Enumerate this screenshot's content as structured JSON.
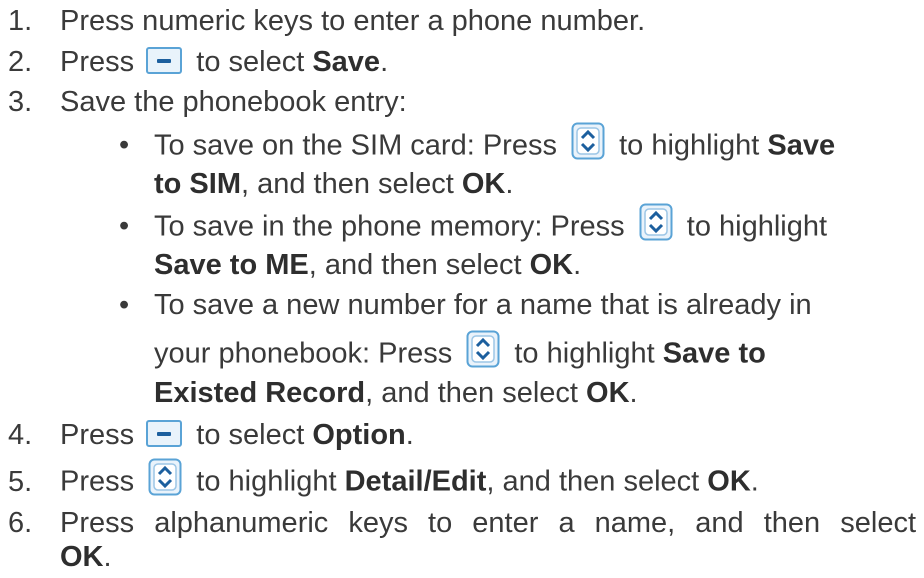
{
  "steps": [
    {
      "num": "1.",
      "text": "Press numeric keys to enter a phone number."
    },
    {
      "num": "2.",
      "pre": "Press",
      "icon": "soft-key-icon",
      "mid": "to select ",
      "bold": "Save",
      "post": "."
    },
    {
      "num": "3.",
      "text": "Save the phonebook entry:"
    },
    {
      "num": "4.",
      "pre": "Press",
      "icon": "soft-key-icon",
      "mid": "to select ",
      "bold": "Option",
      "post": "."
    },
    {
      "num": "5.",
      "pre": "Press",
      "icon": "nav-key-icon",
      "mid": "to highlight ",
      "bold": "Detail/Edit",
      "mid2": ", and then select ",
      "bold2": "OK",
      "post": "."
    },
    {
      "num": "6.",
      "text": "Press alphanumeric keys to enter a name, and then select",
      "bold_line2": "OK",
      "post": "."
    }
  ],
  "bullets": [
    {
      "line1_pre": "To save on the SIM card: Press",
      "line1_mid": "to highlight ",
      "line1_bold": "Save",
      "line2_bold": "to SIM",
      "line2_mid": ", and then select ",
      "line2_bold2": "OK",
      "line2_post": "."
    },
    {
      "line1_pre": "To save in the phone memory: Press",
      "line1_mid": "to highlight",
      "line2_bold": "Save to ME",
      "line2_mid": ", and then select ",
      "line2_bold2": "OK",
      "line2_post": "."
    },
    {
      "line1_pre": "To save a new number for a name that is already in",
      "line2_pre": "your phonebook: Press",
      "line2_mid": "to highlight ",
      "line2_bold": "Save to",
      "line3_bold": "Existed Record",
      "line3_mid": ", and then select ",
      "line3_bold2": "OK",
      "line3_post": "."
    }
  ],
  "bullet_char": "•"
}
